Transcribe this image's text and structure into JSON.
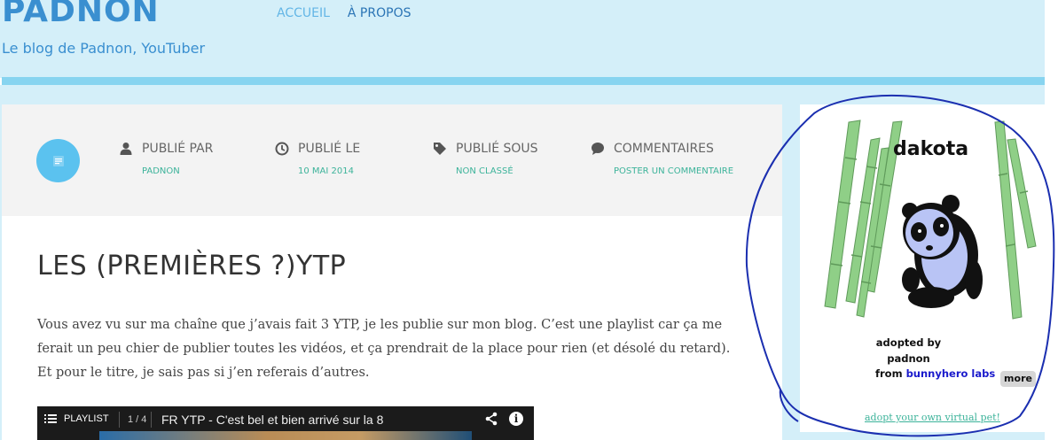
{
  "header": {
    "site_title": "PADNON",
    "tagline": "Le blog de Padnon, YouTuber",
    "nav": [
      {
        "label": "ACCUEIL"
      },
      {
        "label": "À PROPOS"
      }
    ]
  },
  "post_meta": {
    "author_label": "PUBLIÉ PAR",
    "author_value": "PADNON",
    "date_label": "PUBLIÉ LE",
    "date_value": "10 MAI 2014",
    "category_label": "PUBLIÉ SOUS",
    "category_value": "NON CLASSÉ",
    "comments_label": "COMMENTAIRES",
    "comments_value": "POSTER UN COMMENTAIRE"
  },
  "post": {
    "title": "LES (PREMIÈRES ?)YTP",
    "body": "Vous avez vu sur ma chaîne que j’avais fait 3 YTP, je les publie sur mon blog. C’est une playlist car ça me ferait un peu chier de publier toutes les vidéos, et ça prendrait de la place pour rien (et désolé du retard). Et pour le titre, je sais pas si j’en referais d’autres."
  },
  "video": {
    "playlist_label": "PLAYLIST",
    "count": "1 / 4",
    "title": "FR YTP - C'est bel et bien arrivé sur la 8"
  },
  "widget": {
    "pet_name": "dakota",
    "adopted_line1": "adopted by",
    "adopted_line2": "padnon",
    "from_label": "from",
    "brand": "bunnyhero labs",
    "more_label": "more",
    "adopt_link": "adopt your own virtual pet!"
  },
  "colors": {
    "header_bg": "#d4eff9",
    "header_bar": "#87d4f0",
    "title_blue": "#3a8fd0",
    "accent_green": "#3cb39a",
    "post_icon_bg": "#5bc2ef",
    "annotation_ink": "#1b2fb0"
  },
  "icons": {
    "post": "document-icon",
    "author": "user-icon",
    "date": "clock-icon",
    "category": "tag-icon",
    "comments": "comment-icon",
    "share": "share-icon",
    "info": "info-icon"
  }
}
